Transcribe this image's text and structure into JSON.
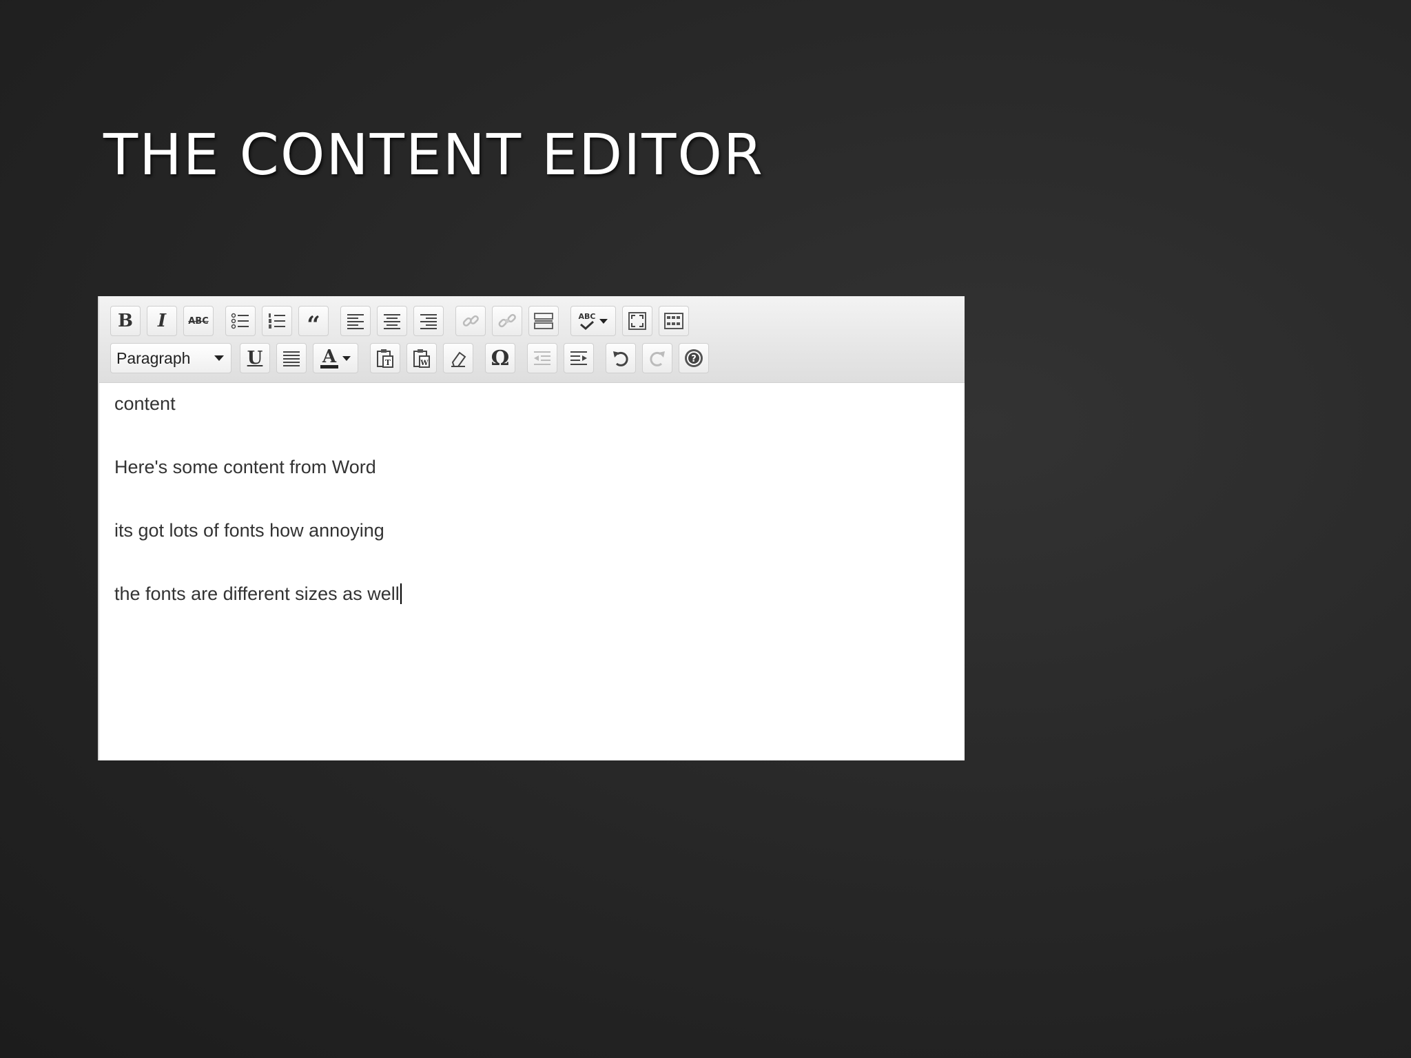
{
  "slide": {
    "title": "THE CONTENT EDITOR"
  },
  "editor": {
    "toolbar_row1": {
      "bold_label": "B",
      "italic_label": "I",
      "strikethrough_label": "ABC",
      "blockquote_label": "“",
      "spellcheck_label": "ABC"
    },
    "toolbar_row2": {
      "format_select_value": "Paragraph",
      "underline_label": "U",
      "text_color_label": "A",
      "special_char_label": "Ω"
    },
    "content": {
      "paragraphs": [
        "content",
        "Here's some content from Word",
        "its got lots of fonts how annoying",
        "the fonts are different sizes as well"
      ]
    }
  },
  "icons": [
    "bold-icon",
    "italic-icon",
    "strikethrough-icon",
    "bullet-list-icon",
    "numbered-list-icon",
    "blockquote-icon",
    "align-left-icon",
    "align-center-icon",
    "align-right-icon",
    "link-icon",
    "unlink-icon",
    "more-tag-icon",
    "spellcheck-icon",
    "fullscreen-icon",
    "kitchen-sink-icon",
    "underline-icon",
    "justify-icon",
    "text-color-icon",
    "paste-text-icon",
    "paste-word-icon",
    "eraser-icon",
    "omega-icon",
    "outdent-icon",
    "indent-icon",
    "undo-icon",
    "redo-icon",
    "help-icon"
  ]
}
